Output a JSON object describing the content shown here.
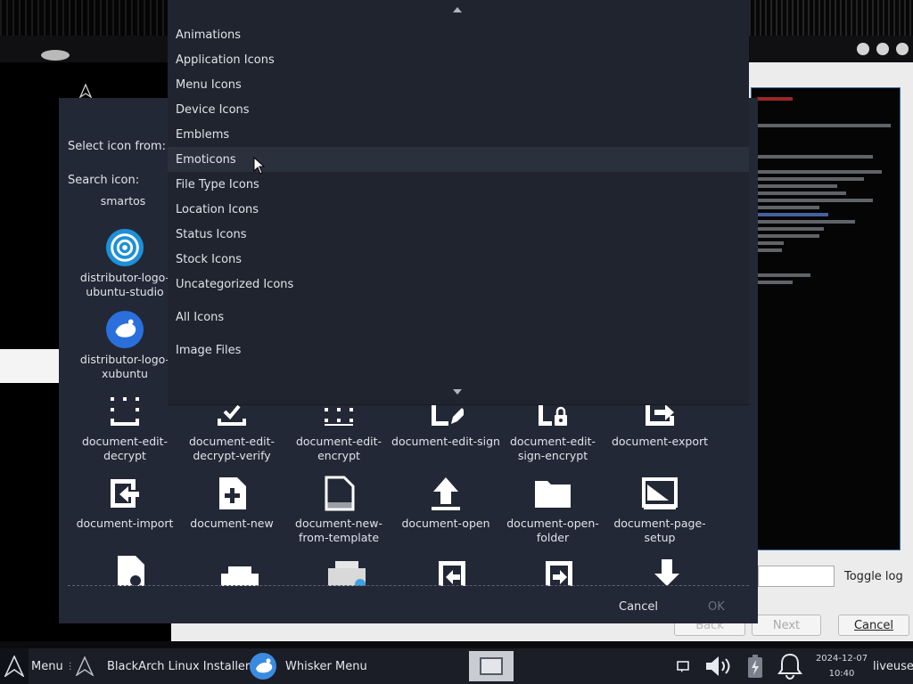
{
  "installer": {
    "toggle_log": "Toggle log",
    "back_label": "Back",
    "next_label": "Next",
    "cancel_label": "Cancel"
  },
  "dialog": {
    "select_label": "Select icon from:",
    "search_label": "Search icon:",
    "cancel_label": "Cancel",
    "ok_label": "OK",
    "partial_label": "smartos",
    "icons": [
      {
        "label": "distributor-logo-ubuntu-studio",
        "icon": "ubuntu-studio-logo-icon"
      },
      {
        "label": "distributor-logo-xubuntu",
        "icon": "xubuntu-logo-icon"
      },
      {
        "label": "document-edit-decrypt",
        "icon": "document-edit-decrypt-icon"
      },
      {
        "label": "document-edit-decrypt-verify",
        "icon": "document-edit-decrypt-verify-icon"
      },
      {
        "label": "document-edit-encrypt",
        "icon": "document-edit-encrypt-icon"
      },
      {
        "label": "document-edit-sign",
        "icon": "document-edit-sign-icon"
      },
      {
        "label": "document-edit-sign-encrypt",
        "icon": "document-edit-sign-encrypt-icon"
      },
      {
        "label": "document-export",
        "icon": "document-export-icon"
      },
      {
        "label": "document-import",
        "icon": "document-import-icon"
      },
      {
        "label": "document-new",
        "icon": "document-new-icon"
      },
      {
        "label": "document-new-from-template",
        "icon": "document-new-from-template-icon"
      },
      {
        "label": "document-open",
        "icon": "document-open-icon"
      },
      {
        "label": "document-open-folder",
        "icon": "folder-icon"
      },
      {
        "label": "document-page-setup",
        "icon": "document-page-setup-icon"
      }
    ]
  },
  "dropdown": {
    "items": [
      "Animations",
      "Application Icons",
      "Menu Icons",
      "Device Icons",
      "Emblems",
      "Emoticons",
      "File Type Icons",
      "Location Icons",
      "Status Icons",
      "Stock Icons",
      "Uncategorized Icons",
      "All Icons",
      "Image Files"
    ],
    "highlighted_index": 5
  },
  "taskbar": {
    "menu_label": "Menu",
    "installer_label": "BlackArch Linux Installer",
    "whisker_label": "Whisker Menu",
    "date": "2024-12-07",
    "time": "10:40",
    "user": "liveuser"
  },
  "colors": {
    "dialog_bg": "#232836",
    "dropdown_bg": "#20242f",
    "highlight": "#2b303d",
    "taskbar_bg": "#1b1e27",
    "ubuntu_blue": "#1e90d8"
  }
}
